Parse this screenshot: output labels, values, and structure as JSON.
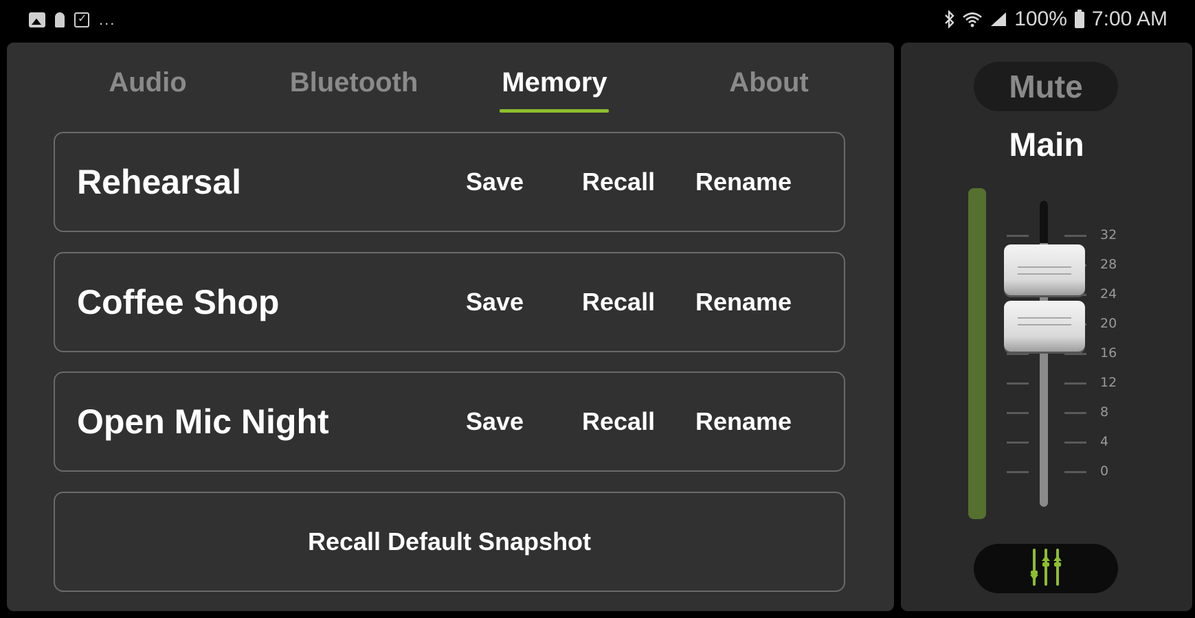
{
  "status_bar": {
    "battery": "100%",
    "time": "7:00 AM",
    "more": "...",
    "icons_left": [
      "photo-icon",
      "key-icon",
      "checkbox-icon"
    ],
    "icons_right": [
      "bluetooth-icon",
      "wifi-icon",
      "signal-icon",
      "battery-icon"
    ]
  },
  "tabs": [
    {
      "label": "Audio",
      "active": false
    },
    {
      "label": "Bluetooth",
      "active": false
    },
    {
      "label": "Memory",
      "active": true
    },
    {
      "label": "About",
      "active": false
    }
  ],
  "memory_slots": [
    {
      "name": "Rehearsal",
      "save": "Save",
      "recall": "Recall",
      "rename": "Rename"
    },
    {
      "name": "Coffee Shop",
      "save": "Save",
      "recall": "Recall",
      "rename": "Rename"
    },
    {
      "name": "Open Mic Night",
      "save": "Save",
      "recall": "Recall",
      "rename": "Rename"
    }
  ],
  "default_snapshot": "Recall Default Snapshot",
  "side": {
    "mute": "Mute",
    "channel": "Main",
    "scale": [
      "32",
      "28",
      "24",
      "20",
      "16",
      "12",
      "8",
      "4",
      "0"
    ],
    "eq_icon": "sliders-icon"
  },
  "colors": {
    "accent": "#8dbf2e",
    "meter": "#55702f",
    "panel": "#313131"
  }
}
